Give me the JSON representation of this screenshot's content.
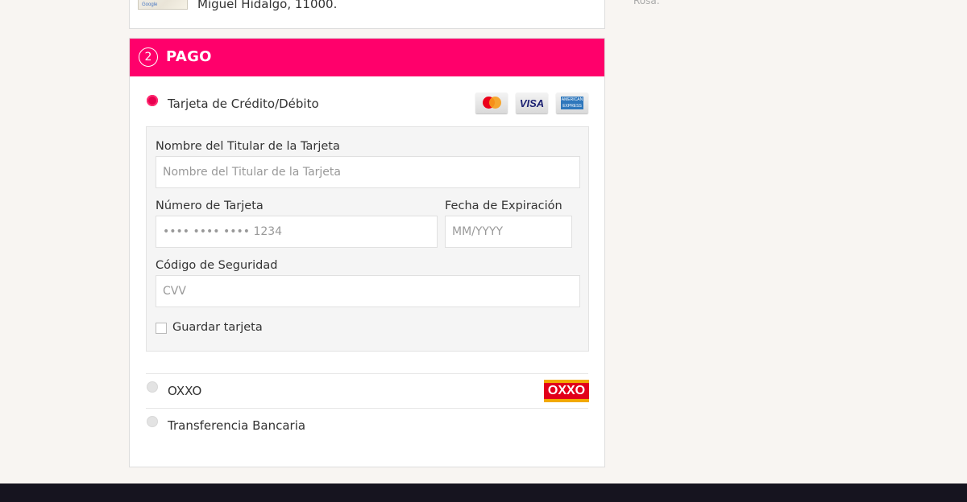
{
  "shipping": {
    "address_fragment": "Miguel Hidalgo, 11000.",
    "map_logo_text": "Google",
    "side_note": "Rosa."
  },
  "payment": {
    "step_number": "2",
    "title": "PAGO",
    "accent_color": "#ff006b",
    "methods": [
      {
        "label": "Tarjeta de Crédito/Débito",
        "selected": true,
        "logos": [
          "mastercard-icon",
          "visa-icon",
          "amex-icon"
        ]
      },
      {
        "label": "OXXO",
        "selected": false,
        "logos": [
          "oxxo-icon"
        ]
      },
      {
        "label": "Transferencia Bancaria",
        "selected": false,
        "logos": []
      }
    ],
    "card_logo_text": {
      "visa": "VISA",
      "amex": "AMERICAN EXPRESS",
      "oxxo": "OXXO"
    },
    "card_form": {
      "holder_label": "Nombre del Titular de la Tarjeta",
      "holder_placeholder": "Nombre del Titular de la Tarjeta",
      "holder_value": "",
      "number_label": "Número de Tarjeta",
      "number_placeholder": "•••• •••• •••• 1234",
      "number_value": "",
      "expiry_label": "Fecha de Expiración",
      "expiry_placeholder": "MM/YYYY",
      "expiry_value": "",
      "cvv_label": "Código de Seguridad",
      "cvv_placeholder": "CVV",
      "cvv_value": "",
      "save_card_label": "Guardar tarjeta",
      "save_card_checked": false
    }
  }
}
